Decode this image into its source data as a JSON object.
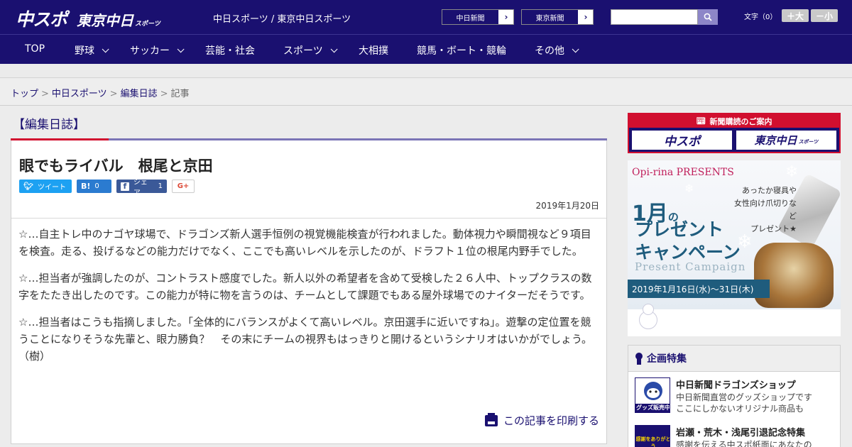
{
  "header": {
    "logo_main": "中スポ",
    "logo_sub": "東京中日",
    "logo_sub_small": "スポーツ",
    "site_title": "中日スポーツ / 東京中日スポーツ",
    "paper_buttons": [
      {
        "label": "中日新聞"
      },
      {
        "label": "東京新聞"
      }
    ],
    "search": {
      "placeholder": "",
      "value": ""
    },
    "font_size_label": "文字（0）",
    "font_plus": "＋大",
    "font_minus": "－小"
  },
  "nav": {
    "items": [
      {
        "label": "TOP",
        "has_dropdown": false
      },
      {
        "label": "野球",
        "has_dropdown": true
      },
      {
        "label": "サッカー",
        "has_dropdown": true
      },
      {
        "label": "芸能・社会",
        "has_dropdown": false
      },
      {
        "label": "スポーツ",
        "has_dropdown": true
      },
      {
        "label": "大相撲",
        "has_dropdown": false
      },
      {
        "label": "競馬・ボート・競輪",
        "has_dropdown": false
      },
      {
        "label": "その他",
        "has_dropdown": true
      }
    ]
  },
  "breadcrumb": {
    "items": [
      "トップ",
      "中日スポーツ",
      "編集日誌"
    ],
    "current": "記事",
    "separator": ">"
  },
  "section_title": "【編集日誌】",
  "article": {
    "title": "眼でもライバル　根尾と京田",
    "share": {
      "tweet": "ツイート",
      "hatena_count": "0",
      "facebook_label": "シェア",
      "facebook_count": "1",
      "gplus": "G+"
    },
    "date": "2019年1月20日",
    "paragraphs": [
      "☆…自主トレ中のナゴヤ球場で、ドラゴンズ新人選手恒例の視覚機能検査が行われました。動体視力や瞬間視など９項目を検査。走る、投げるなどの能力だけでなく、ここでも高いレベルを示したのが、ドラフト１位の根尾内野手でした。",
      "☆…担当者が強調したのが、コントラスト感度でした。新人以外の希望者を含めて受検した２６人中、トップクラスの数字をたたき出したのです。この能力が特に物を言うのは、チームとして課題でもある屋外球場でのナイターだそうです。",
      "☆…担当者はこうも指摘しました。「全体的にバランスがよくて高いレベル。京田選手に近いですね」。遊撃の定位置を競うことになりそうな先輩と、眼力勝負？　その末にチームの視界もはっきりと開けるというシナリオはいかがでしょう。（樹）"
    ],
    "print_label": "この記事を印刷する"
  },
  "sidebar": {
    "subscribe": {
      "heading": "新聞購読のご案内",
      "logos": [
        "中スポ",
        "東京中日"
      ],
      "logo_small": "スポーツ"
    },
    "banner": {
      "brand": "Opi-rina PRESENTS",
      "promo_lines": [
        "あったか寝具や",
        "女性向け爪切りなど",
        "プレゼント★"
      ],
      "month": "1月",
      "month_suffix": "の",
      "title_line1": "プレゼント",
      "title_line2": "キャンペーン",
      "subtitle": "Present Campaign",
      "dates": "2019年1月16日(水)～31日(木)"
    },
    "feature": {
      "heading": "企画特集",
      "items": [
        {
          "title": "中日新聞ドラゴンズショップ",
          "desc_lines": [
            "中日新聞直営のグッズショップです",
            "ここにしかないオリジナル商品も"
          ],
          "thumb_text": "グッズ販売中"
        },
        {
          "title": "岩瀬・荒木・浅尾引退記念特集",
          "desc_lines": [
            "感謝を伝える中スポ紙面にあなたの"
          ],
          "thumb_text": "感謝をありがとう"
        }
      ]
    }
  },
  "colors": {
    "header_bg": "#1a1070",
    "accent_red": "#d10f2f",
    "accent_purple": "#7b75b6"
  }
}
